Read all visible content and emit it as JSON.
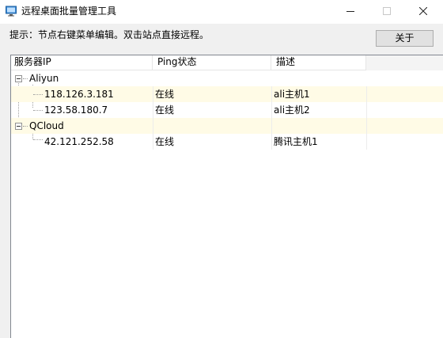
{
  "window": {
    "title": "远程桌面批量管理工具"
  },
  "hint": "提示：节点右键菜单编辑。双击站点直接远程。",
  "about_button": "关于",
  "columns": [
    "服务器IP",
    "Ping状态",
    "描述"
  ],
  "groups": [
    {
      "name": "Aliyun",
      "servers": [
        {
          "ip": "118.126.3.181",
          "status": "在线",
          "desc": "ali主机1"
        },
        {
          "ip": "123.58.180.7",
          "status": "在线",
          "desc": "ali主机2"
        }
      ]
    },
    {
      "name": "QCloud",
      "servers": [
        {
          "ip": "42.121.252.58",
          "status": "在线",
          "desc": "腾讯主机1"
        }
      ]
    }
  ],
  "colors": {
    "selected_row": "#fffbe6",
    "border": "#828790",
    "button": "#e1e1e1"
  }
}
